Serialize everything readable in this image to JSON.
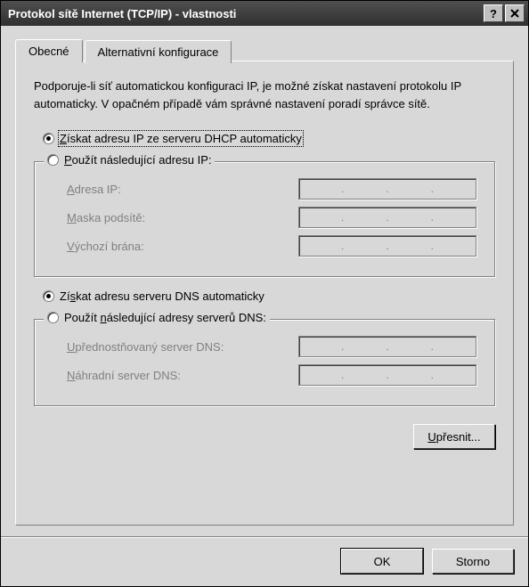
{
  "window": {
    "title": "Protokol sítě Internet (TCP/IP) - vlastnosti"
  },
  "tabs": {
    "general": "Obecné",
    "alternate": "Alternativní konfigurace"
  },
  "description": "Podporuje-li síť automatickou konfiguraci IP, je možné získat nastavení protokolu IP automaticky. V opačném případě vám správné nastavení poradí správce sítě.",
  "ip_section": {
    "auto_label_pre": "Z",
    "auto_label_rest": "ískat adresu IP ze serveru DHCP automaticky",
    "manual_label_pre": "P",
    "manual_label_rest": "oužít následující adresu IP:",
    "ip_addr_pre": "A",
    "ip_addr_rest": "dresa IP:",
    "mask_pre": "M",
    "mask_rest": "aska podsítě:",
    "gw_pre": "V",
    "gw_rest": "ýchozí brána:"
  },
  "dns_section": {
    "auto_label": "Získat adresu serveru DNS automaticky",
    "auto_underline": "s",
    "manual_label": "Použít následující adresy serverů DNS:",
    "manual_underline": "n",
    "pref_pre": "U",
    "pref_rest": "přednostňovaný server DNS:",
    "alt_pre": "N",
    "alt_rest": "áhradní server DNS:"
  },
  "buttons": {
    "advanced_pre": "U",
    "advanced_rest": "přesnit...",
    "ok": "OK",
    "cancel": "Storno"
  }
}
